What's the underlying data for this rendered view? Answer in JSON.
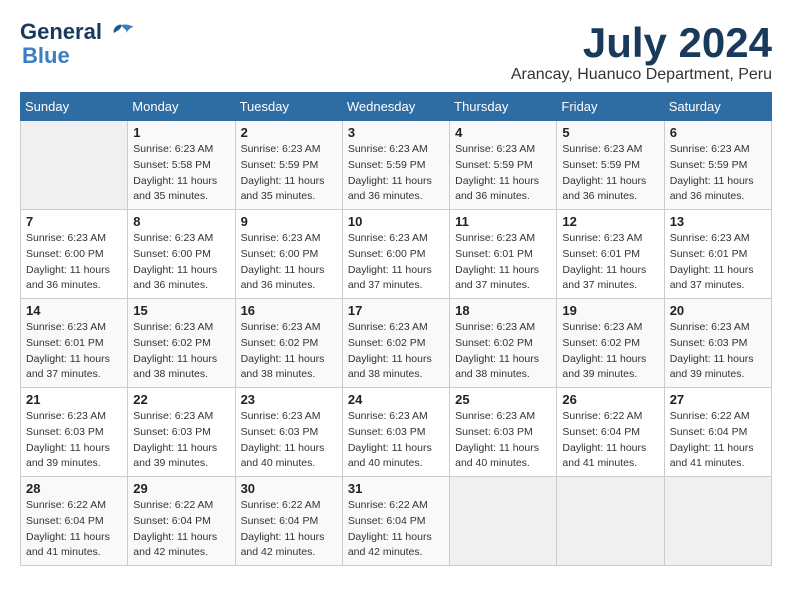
{
  "logo": {
    "line1": "General",
    "line2": "Blue"
  },
  "title": "July 2024",
  "location": "Arancay, Huanuco Department, Peru",
  "days_header": [
    "Sunday",
    "Monday",
    "Tuesday",
    "Wednesday",
    "Thursday",
    "Friday",
    "Saturday"
  ],
  "weeks": [
    [
      {
        "day": "",
        "sunrise": "",
        "sunset": "",
        "daylight": ""
      },
      {
        "day": "1",
        "sunrise": "Sunrise: 6:23 AM",
        "sunset": "Sunset: 5:58 PM",
        "daylight": "Daylight: 11 hours and 35 minutes."
      },
      {
        "day": "2",
        "sunrise": "Sunrise: 6:23 AM",
        "sunset": "Sunset: 5:59 PM",
        "daylight": "Daylight: 11 hours and 35 minutes."
      },
      {
        "day": "3",
        "sunrise": "Sunrise: 6:23 AM",
        "sunset": "Sunset: 5:59 PM",
        "daylight": "Daylight: 11 hours and 36 minutes."
      },
      {
        "day": "4",
        "sunrise": "Sunrise: 6:23 AM",
        "sunset": "Sunset: 5:59 PM",
        "daylight": "Daylight: 11 hours and 36 minutes."
      },
      {
        "day": "5",
        "sunrise": "Sunrise: 6:23 AM",
        "sunset": "Sunset: 5:59 PM",
        "daylight": "Daylight: 11 hours and 36 minutes."
      },
      {
        "day": "6",
        "sunrise": "Sunrise: 6:23 AM",
        "sunset": "Sunset: 5:59 PM",
        "daylight": "Daylight: 11 hours and 36 minutes."
      }
    ],
    [
      {
        "day": "7",
        "sunrise": "Sunrise: 6:23 AM",
        "sunset": "Sunset: 6:00 PM",
        "daylight": "Daylight: 11 hours and 36 minutes."
      },
      {
        "day": "8",
        "sunrise": "Sunrise: 6:23 AM",
        "sunset": "Sunset: 6:00 PM",
        "daylight": "Daylight: 11 hours and 36 minutes."
      },
      {
        "day": "9",
        "sunrise": "Sunrise: 6:23 AM",
        "sunset": "Sunset: 6:00 PM",
        "daylight": "Daylight: 11 hours and 36 minutes."
      },
      {
        "day": "10",
        "sunrise": "Sunrise: 6:23 AM",
        "sunset": "Sunset: 6:00 PM",
        "daylight": "Daylight: 11 hours and 37 minutes."
      },
      {
        "day": "11",
        "sunrise": "Sunrise: 6:23 AM",
        "sunset": "Sunset: 6:01 PM",
        "daylight": "Daylight: 11 hours and 37 minutes."
      },
      {
        "day": "12",
        "sunrise": "Sunrise: 6:23 AM",
        "sunset": "Sunset: 6:01 PM",
        "daylight": "Daylight: 11 hours and 37 minutes."
      },
      {
        "day": "13",
        "sunrise": "Sunrise: 6:23 AM",
        "sunset": "Sunset: 6:01 PM",
        "daylight": "Daylight: 11 hours and 37 minutes."
      }
    ],
    [
      {
        "day": "14",
        "sunrise": "Sunrise: 6:23 AM",
        "sunset": "Sunset: 6:01 PM",
        "daylight": "Daylight: 11 hours and 37 minutes."
      },
      {
        "day": "15",
        "sunrise": "Sunrise: 6:23 AM",
        "sunset": "Sunset: 6:02 PM",
        "daylight": "Daylight: 11 hours and 38 minutes."
      },
      {
        "day": "16",
        "sunrise": "Sunrise: 6:23 AM",
        "sunset": "Sunset: 6:02 PM",
        "daylight": "Daylight: 11 hours and 38 minutes."
      },
      {
        "day": "17",
        "sunrise": "Sunrise: 6:23 AM",
        "sunset": "Sunset: 6:02 PM",
        "daylight": "Daylight: 11 hours and 38 minutes."
      },
      {
        "day": "18",
        "sunrise": "Sunrise: 6:23 AM",
        "sunset": "Sunset: 6:02 PM",
        "daylight": "Daylight: 11 hours and 38 minutes."
      },
      {
        "day": "19",
        "sunrise": "Sunrise: 6:23 AM",
        "sunset": "Sunset: 6:02 PM",
        "daylight": "Daylight: 11 hours and 39 minutes."
      },
      {
        "day": "20",
        "sunrise": "Sunrise: 6:23 AM",
        "sunset": "Sunset: 6:03 PM",
        "daylight": "Daylight: 11 hours and 39 minutes."
      }
    ],
    [
      {
        "day": "21",
        "sunrise": "Sunrise: 6:23 AM",
        "sunset": "Sunset: 6:03 PM",
        "daylight": "Daylight: 11 hours and 39 minutes."
      },
      {
        "day": "22",
        "sunrise": "Sunrise: 6:23 AM",
        "sunset": "Sunset: 6:03 PM",
        "daylight": "Daylight: 11 hours and 39 minutes."
      },
      {
        "day": "23",
        "sunrise": "Sunrise: 6:23 AM",
        "sunset": "Sunset: 6:03 PM",
        "daylight": "Daylight: 11 hours and 40 minutes."
      },
      {
        "day": "24",
        "sunrise": "Sunrise: 6:23 AM",
        "sunset": "Sunset: 6:03 PM",
        "daylight": "Daylight: 11 hours and 40 minutes."
      },
      {
        "day": "25",
        "sunrise": "Sunrise: 6:23 AM",
        "sunset": "Sunset: 6:03 PM",
        "daylight": "Daylight: 11 hours and 40 minutes."
      },
      {
        "day": "26",
        "sunrise": "Sunrise: 6:22 AM",
        "sunset": "Sunset: 6:04 PM",
        "daylight": "Daylight: 11 hours and 41 minutes."
      },
      {
        "day": "27",
        "sunrise": "Sunrise: 6:22 AM",
        "sunset": "Sunset: 6:04 PM",
        "daylight": "Daylight: 11 hours and 41 minutes."
      }
    ],
    [
      {
        "day": "28",
        "sunrise": "Sunrise: 6:22 AM",
        "sunset": "Sunset: 6:04 PM",
        "daylight": "Daylight: 11 hours and 41 minutes."
      },
      {
        "day": "29",
        "sunrise": "Sunrise: 6:22 AM",
        "sunset": "Sunset: 6:04 PM",
        "daylight": "Daylight: 11 hours and 42 minutes."
      },
      {
        "day": "30",
        "sunrise": "Sunrise: 6:22 AM",
        "sunset": "Sunset: 6:04 PM",
        "daylight": "Daylight: 11 hours and 42 minutes."
      },
      {
        "day": "31",
        "sunrise": "Sunrise: 6:22 AM",
        "sunset": "Sunset: 6:04 PM",
        "daylight": "Daylight: 11 hours and 42 minutes."
      },
      {
        "day": "",
        "sunrise": "",
        "sunset": "",
        "daylight": ""
      },
      {
        "day": "",
        "sunrise": "",
        "sunset": "",
        "daylight": ""
      },
      {
        "day": "",
        "sunrise": "",
        "sunset": "",
        "daylight": ""
      }
    ]
  ]
}
